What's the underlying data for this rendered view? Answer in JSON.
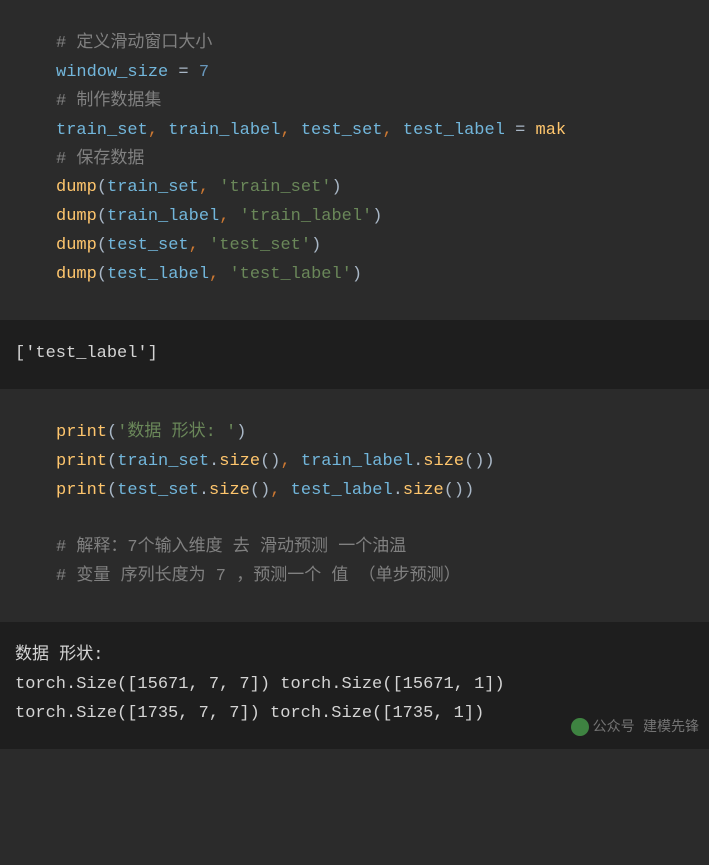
{
  "block1": {
    "comment1": "# 定义滑动窗口大小",
    "var_window": "window_size",
    "equals": " = ",
    "seven": "7",
    "comment2": "# 制作数据集",
    "train_set": "train_set",
    "train_label": "train_label",
    "test_set": "test_set",
    "test_label": "test_label",
    "mak": "mak",
    "comment3": "# 保存数据",
    "dump": "dump",
    "lparen": "(",
    "rparen": ")",
    "comma_sp": ", ",
    "str_train_set": "'train_set'",
    "str_train_label": "'train_label'",
    "str_test_set": "'test_set'",
    "str_test_label": "'test_label'"
  },
  "output1": "['test_label']",
  "block2": {
    "print": "print",
    "str_shape": "'数据 形状: '",
    "train_set": "train_set",
    "train_label": "train_label",
    "test_set": "test_set",
    "test_label": "test_label",
    "size": "size",
    "dot": ".",
    "lparen": "(",
    "rparen": ")",
    "comma_sp": ", ",
    "comment1": "# 解释：7个输入维度 去 滑动预测 一个油温",
    "comment2": "# 变量 序列长度为 7 ，预测一个 值 （单步预测）"
  },
  "output2": {
    "line1": "数据 形状:",
    "line2": "torch.Size([15671, 7, 7]) torch.Size([15671, 1])",
    "line3": "torch.Size([1735, 7, 7]) torch.Size([1735, 1])"
  },
  "watermark": {
    "label": "公众号",
    "name": "建模先锋"
  }
}
